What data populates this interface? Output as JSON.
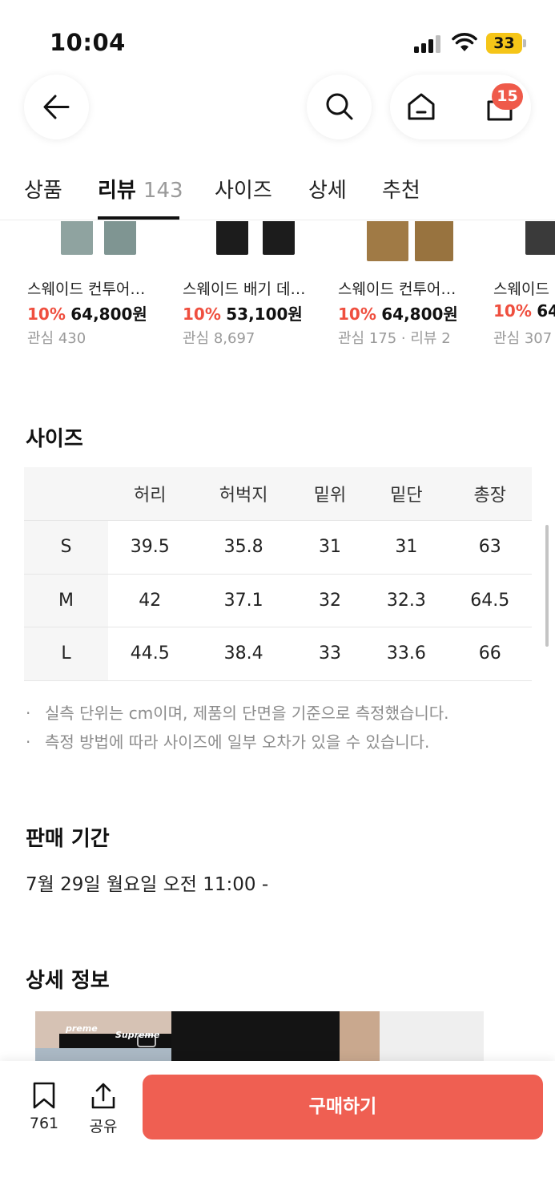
{
  "status_bar": {
    "time": "10:04",
    "battery": "33"
  },
  "header": {
    "cart_badge": "15"
  },
  "tabs": [
    {
      "label": "상품"
    },
    {
      "label": "리뷰",
      "count": "143"
    },
    {
      "label": "사이즈"
    },
    {
      "label": "상세"
    },
    {
      "label": "추천"
    }
  ],
  "recommendations": [
    {
      "name": "스웨이드 컨투어…",
      "discount": "10%",
      "price": "64,800원",
      "meta": "관심 430",
      "color": "#8fa3a0"
    },
    {
      "name": "스웨이드 배기 데…",
      "discount": "10%",
      "price": "53,100원",
      "meta": "관심 8,697",
      "color": "#1c1c1c"
    },
    {
      "name": "스웨이드 컨투어…",
      "discount": "10%",
      "price": "64,800원",
      "meta": "관심 175 · 리뷰 2",
      "color": "#a07a45"
    },
    {
      "name": "스웨이드",
      "discount": "10%",
      "price": "64",
      "meta": "관심 307",
      "color": "#3a3a3a"
    }
  ],
  "size_section": {
    "title": "사이즈",
    "columns": [
      "허리",
      "허벅지",
      "밑위",
      "밑단",
      "총장"
    ],
    "rows": [
      {
        "size": "S",
        "values": [
          "39.5",
          "35.8",
          "31",
          "31",
          "63"
        ]
      },
      {
        "size": "M",
        "values": [
          "42",
          "37.1",
          "32",
          "32.3",
          "64.5"
        ]
      },
      {
        "size": "L",
        "values": [
          "44.5",
          "38.4",
          "33",
          "33.6",
          "66"
        ]
      }
    ],
    "notes": [
      "실측 단위는 cm이며, 제품의 단면을 기준으로 측정했습니다.",
      "측정 방법에 따라 사이즈에 일부 오차가 있을 수 있습니다."
    ]
  },
  "sale_section": {
    "title": "판매 기간",
    "period": "7월 29일 월요일 오전 11:00 -"
  },
  "detail_section": {
    "title": "상세 정보",
    "image_text_1": "preme",
    "image_text_2": "Supreme"
  },
  "bottom_bar": {
    "bookmark_count": "761",
    "share_label": "공유",
    "buy_label": "구매하기"
  }
}
